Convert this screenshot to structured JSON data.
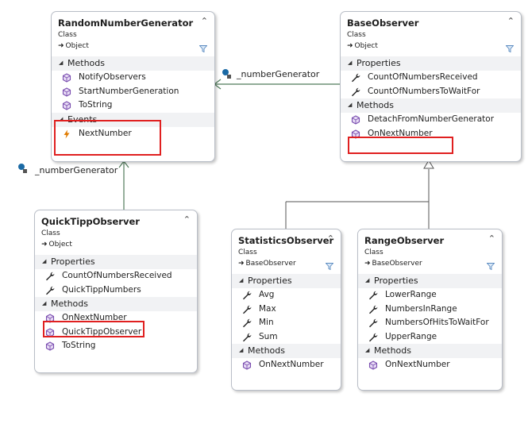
{
  "diagram": {
    "classes": {
      "random_number_generator": {
        "name": "RandomNumberGenerator",
        "kind": "Class",
        "base": "Object",
        "methods_header": "Methods",
        "methods": [
          "NotifyObservers",
          "StartNumberGeneration",
          "ToString"
        ],
        "events_header": "Events",
        "events": [
          "NextNumber"
        ]
      },
      "base_observer": {
        "name": "BaseObserver",
        "kind": "Class",
        "base": "Object",
        "properties_header": "Properties",
        "properties": [
          "CountOfNumbersReceived",
          "CountOfNumbersToWaitFor"
        ],
        "methods_header": "Methods",
        "methods": [
          "DetachFromNumberGenerator",
          "OnNextNumber"
        ]
      },
      "quick_tipp_observer": {
        "name": "QuickTippObserver",
        "kind": "Class",
        "base": "Object",
        "properties_header": "Properties",
        "properties": [
          "CountOfNumbersReceived",
          "QuickTippNumbers"
        ],
        "methods_header": "Methods",
        "methods": [
          "OnNextNumber",
          "QuickTippObserver",
          "ToString"
        ]
      },
      "statistics_observer": {
        "name": "StatisticsObserver",
        "kind": "Class",
        "base": "BaseObserver",
        "properties_header": "Properties",
        "properties": [
          "Avg",
          "Max",
          "Min",
          "Sum"
        ],
        "methods_header": "Methods",
        "methods": [
          "OnNextNumber"
        ]
      },
      "range_observer": {
        "name": "RangeObserver",
        "kind": "Class",
        "base": "BaseObserver",
        "properties_header": "Properties",
        "properties": [
          "LowerRange",
          "NumbersInRange",
          "NumbersOfHitsToWaitFor",
          "UpperRange"
        ],
        "methods_header": "Methods",
        "methods": [
          "OnNextNumber"
        ]
      }
    },
    "associations": [
      {
        "label": "_numberGenerator",
        "from": "BaseObserver",
        "to": "RandomNumberGenerator"
      },
      {
        "label": "_numberGenerator",
        "from": "QuickTippObserver",
        "to": "RandomNumberGenerator"
      }
    ],
    "inheritance": [
      {
        "child": "StatisticsObserver",
        "parent": "BaseObserver"
      },
      {
        "child": "RangeObserver",
        "parent": "BaseObserver"
      }
    ],
    "colors": {
      "connector": "#4f7a5a",
      "highlight": "#e02020",
      "method_icon": "#7b4fb0",
      "event_icon": "#e07b00",
      "section_bg": "#f1f2f4"
    },
    "icons": {
      "method": "method-cube-icon",
      "property": "wrench-icon",
      "event": "lightning-icon",
      "field": "field-icon",
      "collapse": "double-chevron-up-icon",
      "filter": "filter-icon"
    }
  }
}
